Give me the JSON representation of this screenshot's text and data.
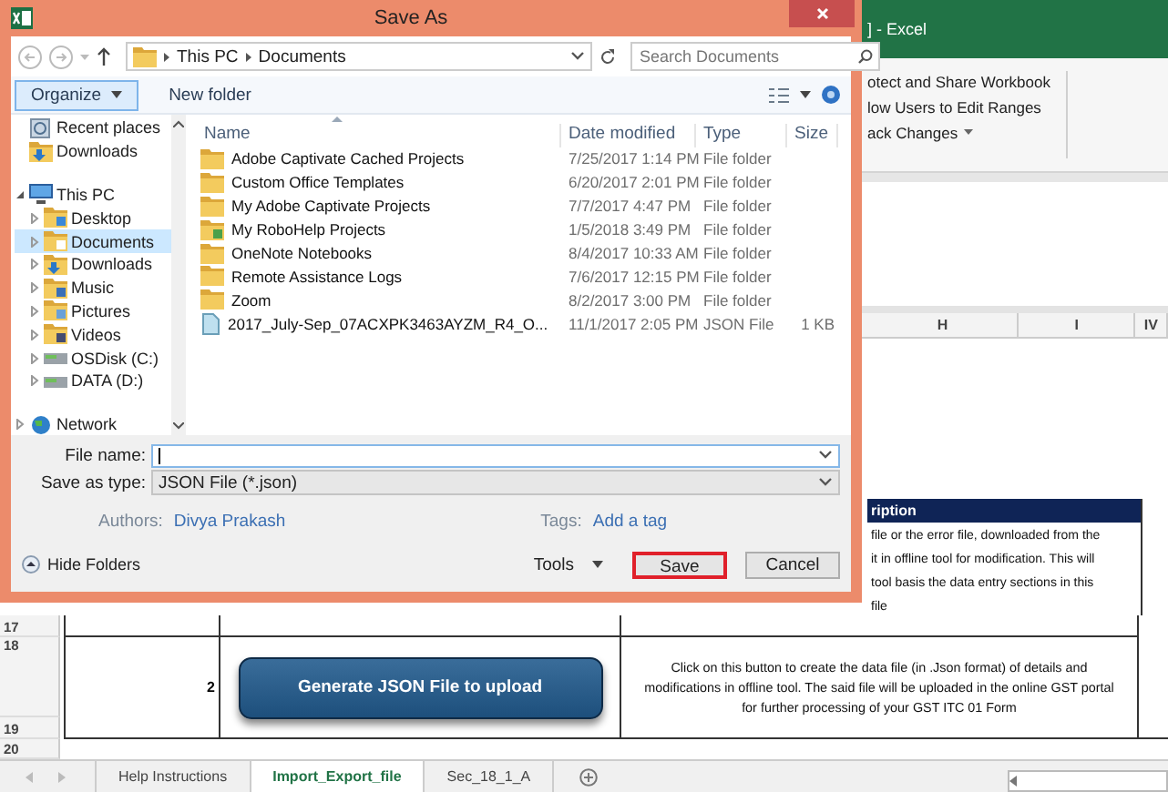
{
  "excel": {
    "title": "] - Excel",
    "ribbon_items": [
      {
        "label": "otect and Share Workbook",
        "kind": "command"
      },
      {
        "label": "low Users to Edit Ranges",
        "kind": "command"
      },
      {
        "label": "ack Changes",
        "kind": "dropdown"
      }
    ],
    "column_headers": [
      "H",
      "I",
      "IV"
    ],
    "description_header": "ription",
    "description_lines": [
      "file or the error file, downloaded from the",
      "it in offline tool for modification. This will",
      "tool basis the data entry sections in this",
      "file"
    ],
    "row_numbers": [
      "17",
      "18",
      "19",
      "20"
    ],
    "table_row": {
      "number": "2",
      "action_button": "Generate JSON File to upload",
      "description": "Click on this button to create the data file (in .Json format) of details and modifications in offline tool. The said file will be uploaded in the online GST portal for further processing of your GST ITC 01 Form"
    },
    "sheet_tabs": [
      {
        "label": "Help Instructions",
        "selected": false
      },
      {
        "label": "Import_Export_file",
        "selected": true
      },
      {
        "label": "Sec_18_1_A",
        "selected": false
      }
    ]
  },
  "dialog": {
    "title": "Save As",
    "breadcrumb": [
      "This PC",
      "Documents"
    ],
    "search": {
      "placeholder": "Search Documents"
    },
    "toolbar": [
      {
        "label": "Organize",
        "kind": "menu"
      },
      {
        "label": "New folder",
        "kind": "command"
      }
    ],
    "navigation": [
      {
        "label": "Recent places",
        "kind": "recent",
        "selected": false
      },
      {
        "label": "Downloads",
        "kind": "downloads",
        "selected": false
      },
      {
        "label": "This PC",
        "kind": "computer",
        "selected": false,
        "expanded": true,
        "children": [
          {
            "label": "Desktop",
            "kind": "desktop",
            "selected": false,
            "expanded": false
          },
          {
            "label": "Documents",
            "kind": "documents",
            "selected": true,
            "expanded": false
          },
          {
            "label": "Downloads",
            "kind": "downloads",
            "selected": false,
            "expanded": false
          },
          {
            "label": "Music",
            "kind": "music",
            "selected": false,
            "expanded": false
          },
          {
            "label": "Pictures",
            "kind": "pictures",
            "selected": false,
            "expanded": false
          },
          {
            "label": "Videos",
            "kind": "videos",
            "selected": false,
            "expanded": false
          },
          {
            "label": "OSDisk (C:)",
            "kind": "drive",
            "selected": false,
            "expanded": false
          },
          {
            "label": "DATA (D:)",
            "kind": "drive",
            "selected": false,
            "expanded": false
          }
        ]
      },
      {
        "label": "Network",
        "kind": "network",
        "selected": false,
        "expanded": false
      }
    ],
    "file_list": {
      "columns": [
        "Name",
        "Date modified",
        "Type",
        "Size"
      ],
      "rows": [
        {
          "name": "Adobe Captivate Cached Projects",
          "date": "7/25/2017 1:14 PM",
          "type": "File folder",
          "kind": "folder"
        },
        {
          "name": "Custom Office Templates",
          "date": "6/20/2017 2:01 PM",
          "type": "File folder",
          "kind": "folder"
        },
        {
          "name": "My Adobe Captivate Projects",
          "date": "7/7/2017 4:47 PM",
          "type": "File folder",
          "kind": "folder"
        },
        {
          "name": "My RoboHelp Projects",
          "date": "1/5/2018 3:49 PM",
          "type": "File folder",
          "kind": "shared-folder"
        },
        {
          "name": "OneNote Notebooks",
          "date": "8/4/2017 10:33 AM",
          "type": "File folder",
          "kind": "folder"
        },
        {
          "name": "Remote Assistance Logs",
          "date": "7/6/2017 12:15 PM",
          "type": "File folder",
          "kind": "folder"
        },
        {
          "name": "Zoom",
          "date": "8/2/2017 3:00 PM",
          "type": "File folder",
          "kind": "folder"
        },
        {
          "name": "2017_July-Sep_07ACXPK3463AYZM_R4_O...",
          "date": "11/1/2017 2:05 PM",
          "type": "JSON File",
          "size": "1 KB",
          "kind": "file"
        }
      ]
    },
    "file_name": {
      "label": "File name:"
    },
    "save_as_type": {
      "label": "Save as type:",
      "value": "JSON File (*.json)"
    },
    "authors": {
      "label": "Authors:",
      "value": "Divya Prakash"
    },
    "tags": {
      "label": "Tags:",
      "value": "Add a tag"
    },
    "hide_folders": "Hide Folders",
    "tools": "Tools",
    "buttons": [
      {
        "label": "Save",
        "highlighted": true
      },
      {
        "label": "Cancel",
        "highlighted": false
      }
    ]
  }
}
